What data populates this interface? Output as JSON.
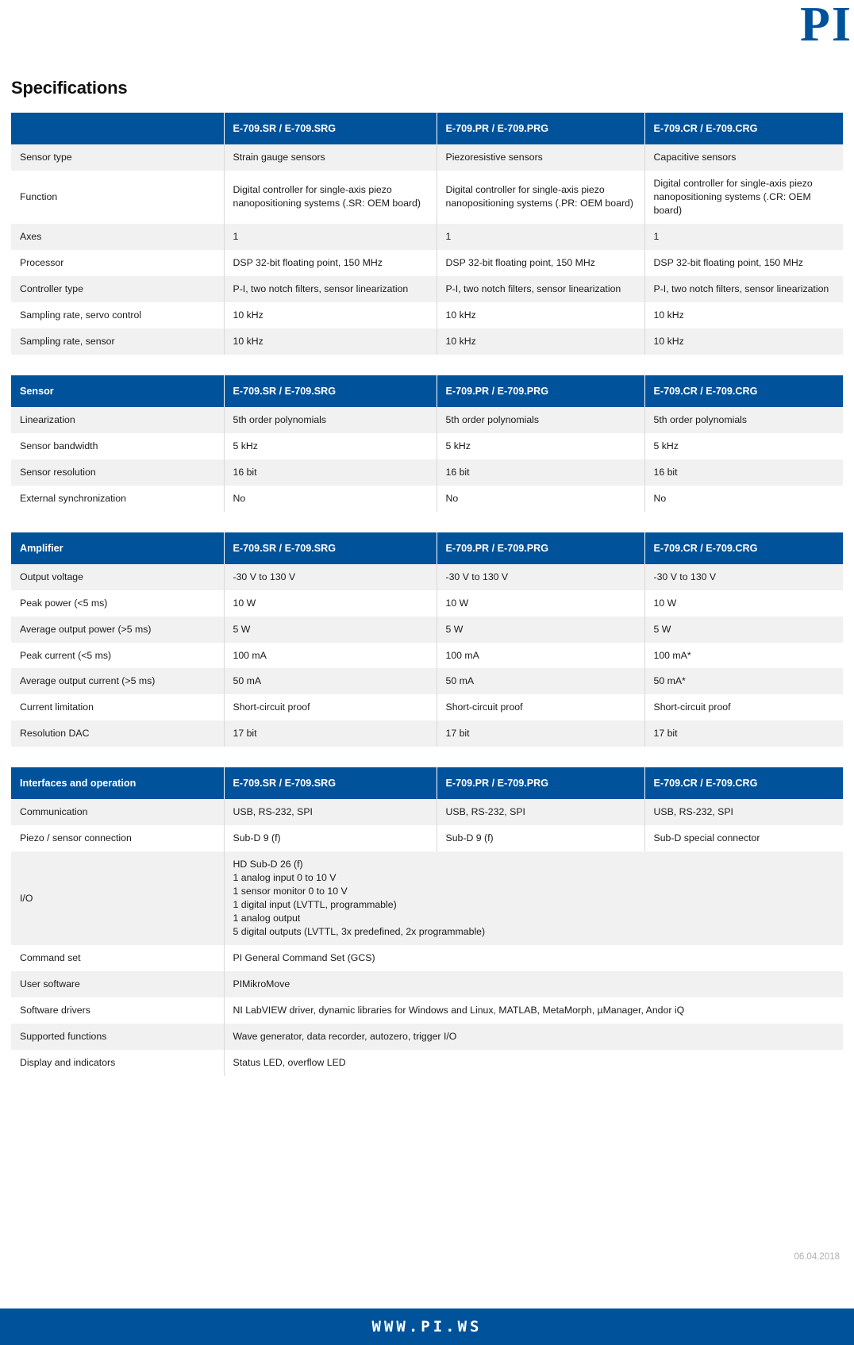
{
  "header": {
    "logo_text": "PI"
  },
  "page_title": "Specifications",
  "footer": {
    "date": "06.04.2018",
    "url": "WWW.PI.WS"
  },
  "models": {
    "sr": "E-709.SR / E-709.SRG",
    "pr": "E-709.PR / E-709.PRG",
    "cr": "E-709.CR / E-709.CRG"
  },
  "tables": [
    {
      "id": "general",
      "headers": [
        "",
        "E-709.SR / E-709.SRG",
        "E-709.PR / E-709.PRG",
        "E-709.CR / E-709.CRG"
      ],
      "rows": [
        {
          "label": "Sensor type",
          "values": [
            "Strain gauge sensors",
            "Piezoresistive sensors",
            "Capacitive sensors"
          ]
        },
        {
          "label": "Function",
          "values": [
            "Digital controller for single-axis piezo nanopositioning systems (.SR: OEM board)",
            "Digital controller for single-axis piezo nanopositioning systems (.PR: OEM board)",
            "Digital controller for single-axis piezo nanopositioning systems (.CR: OEM board)"
          ]
        },
        {
          "label": "Axes",
          "values": [
            "1",
            "1",
            "1"
          ]
        },
        {
          "label": "Processor",
          "values": [
            "DSP 32-bit floating point, 150 MHz",
            "DSP 32-bit floating point, 150 MHz",
            "DSP 32-bit floating point, 150 MHz"
          ]
        },
        {
          "label": "Controller type",
          "values": [
            "P-I, two notch filters, sensor linearization",
            "P-I, two notch filters, sensor linearization",
            "P-I, two notch filters, sensor linearization"
          ]
        },
        {
          "label": "Sampling rate, servo control",
          "values": [
            "10 kHz",
            "10 kHz",
            "10 kHz"
          ]
        },
        {
          "label": "Sampling rate, sensor",
          "values": [
            "10 kHz",
            "10 kHz",
            "10 kHz"
          ]
        }
      ]
    },
    {
      "id": "sensor",
      "headers": [
        "Sensor",
        "E-709.SR / E-709.SRG",
        "E-709.PR / E-709.PRG",
        "E-709.CR / E-709.CRG"
      ],
      "rows": [
        {
          "label": "Linearization",
          "values": [
            "5th order polynomials",
            "5th order polynomials",
            "5th order polynomials"
          ]
        },
        {
          "label": "Sensor bandwidth",
          "values": [
            "5 kHz",
            "5 kHz",
            "5 kHz"
          ]
        },
        {
          "label": "Sensor resolution",
          "values": [
            "16 bit",
            "16 bit",
            "16 bit"
          ]
        },
        {
          "label": "External synchronization",
          "values": [
            "No",
            "No",
            "No"
          ]
        }
      ]
    },
    {
      "id": "amplifier",
      "headers": [
        "Amplifier",
        "E-709.SR / E-709.SRG",
        "E-709.PR / E-709.PRG",
        "E-709.CR / E-709.CRG"
      ],
      "rows": [
        {
          "label": "Output voltage",
          "values": [
            "-30 V to 130 V",
            "-30 V to 130 V",
            "-30 V to 130 V"
          ]
        },
        {
          "label": "Peak power (<5 ms)",
          "values": [
            "10 W",
            "10 W",
            "10 W"
          ]
        },
        {
          "label": "Average output power (>5 ms)",
          "values": [
            "5 W",
            "5 W",
            "5 W"
          ]
        },
        {
          "label": "Peak current (<5 ms)",
          "values": [
            "100 mA",
            "100 mA",
            "100 mA*"
          ]
        },
        {
          "label": "Average output current (>5 ms)",
          "values": [
            "50 mA",
            "50 mA",
            "50 mA*"
          ]
        },
        {
          "label": "Current limitation",
          "values": [
            "Short-circuit proof",
            "Short-circuit proof",
            "Short-circuit proof"
          ]
        },
        {
          "label": "Resolution DAC",
          "values": [
            "17 bit",
            "17 bit",
            "17 bit"
          ]
        }
      ]
    },
    {
      "id": "interfaces",
      "headers": [
        "Interfaces and operation",
        "E-709.SR / E-709.SRG",
        "E-709.PR / E-709.PRG",
        "E-709.CR / E-709.CRG"
      ],
      "rows": [
        {
          "label": "Communication",
          "values": [
            "USB, RS-232, SPI",
            "USB, RS-232, SPI",
            "USB, RS-232, SPI"
          ]
        },
        {
          "label": "Piezo / sensor connection",
          "values": [
            "Sub-D 9 (f)",
            "Sub-D 9 (f)",
            "Sub-D special connector"
          ]
        },
        {
          "label": "I/O",
          "span_value": "HD Sub-D 26 (f)\n1 analog input 0 to 10 V\n1 sensor monitor 0 to 10 V\n1 digital input (LVTTL, programmable)\n1 analog output\n5 digital outputs (LVTTL, 3x predefined, 2x programmable)"
        },
        {
          "label": "Command set",
          "span_value": "PI General Command Set (GCS)"
        },
        {
          "label": "User software",
          "span_value": "PIMikroMove"
        },
        {
          "label": "Software drivers",
          "span_value": "NI LabVIEW driver, dynamic libraries for Windows and Linux, MATLAB, MetaMorph, µManager, Andor iQ"
        },
        {
          "label": "Supported functions",
          "span_value": "Wave generator, data recorder, autozero, trigger I/O"
        },
        {
          "label": "Display and indicators",
          "span_value": "Status LED, overflow LED"
        }
      ]
    }
  ]
}
